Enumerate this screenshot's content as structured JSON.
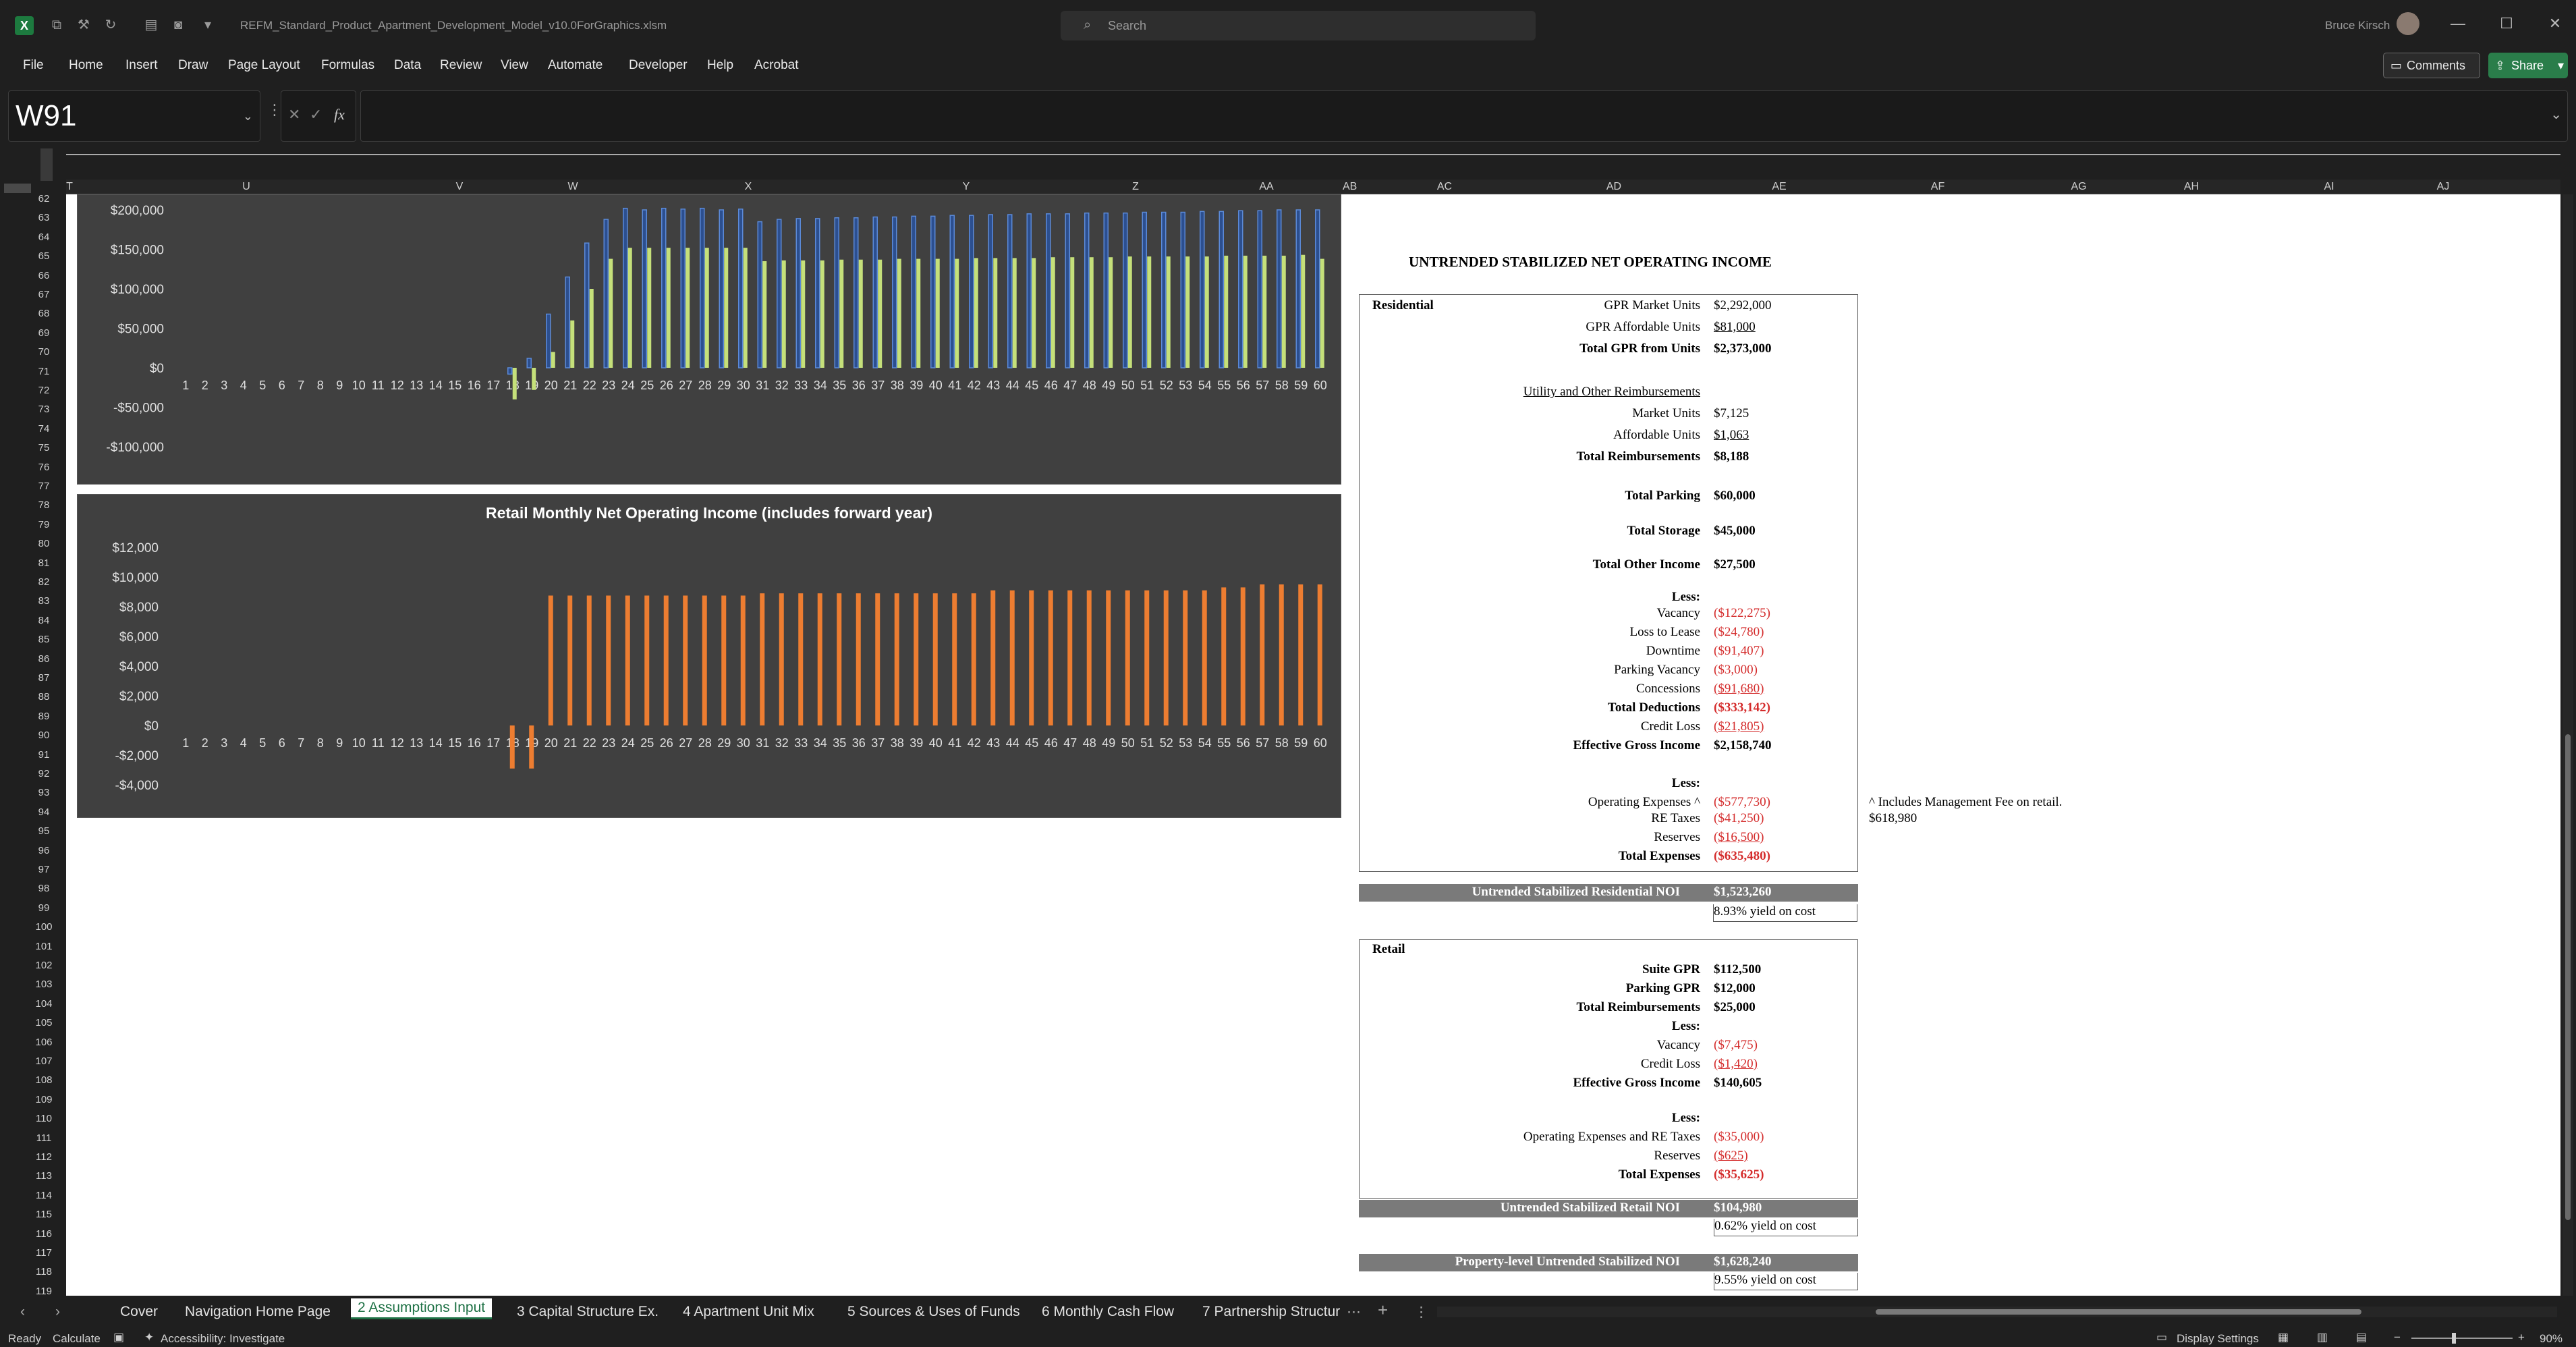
{
  "window": {
    "filename": "REFM_Standard_Product_Apartment_Development_Model_v10.0ForGraphics.xlsm",
    "search_placeholder": "Search",
    "user_name": "Bruce Kirsch"
  },
  "menu": [
    "File",
    "Home",
    "Insert",
    "Draw",
    "Page Layout",
    "Formulas",
    "Data",
    "Review",
    "View",
    "Automate",
    "Developer",
    "Help",
    "Acrobat"
  ],
  "buttons": {
    "comments": "Comments",
    "share": "Share"
  },
  "formula_bar": {
    "name_box": "W91",
    "fx": "fx",
    "content": ""
  },
  "columns": [
    "T",
    "U",
    "V",
    "W",
    "X",
    "Y",
    "Z",
    "AA",
    "AB",
    "AC",
    "AD",
    "AE",
    "AF",
    "AG",
    "AH",
    "AI",
    "AJ"
  ],
  "rows": [
    62,
    63,
    64,
    65,
    66,
    67,
    68,
    69,
    70,
    71,
    72,
    73,
    74,
    75,
    76,
    77,
    78,
    79,
    80,
    81,
    82,
    83,
    84,
    85,
    86,
    87,
    88,
    89,
    90,
    91,
    92,
    93,
    94,
    95,
    96,
    97,
    98,
    99,
    100,
    101,
    102,
    103,
    104,
    105,
    106,
    107,
    108,
    109,
    110,
    111,
    112,
    113,
    114,
    115,
    116,
    117,
    118,
    119
  ],
  "chart_data": [
    {
      "type": "bar",
      "title": "",
      "ylim": [
        -100000,
        200000
      ],
      "yticks": [
        "$200,000",
        "$150,000",
        "$100,000",
        "$50,000",
        "$0",
        "-$50,000",
        "-$100,000"
      ],
      "categories": [
        1,
        2,
        3,
        4,
        5,
        6,
        7,
        8,
        9,
        10,
        11,
        12,
        13,
        14,
        15,
        16,
        17,
        18,
        19,
        20,
        21,
        22,
        23,
        24,
        25,
        26,
        27,
        28,
        29,
        30,
        31,
        32,
        33,
        34,
        35,
        36,
        37,
        38,
        39,
        40,
        41,
        42,
        43,
        44,
        45,
        46,
        47,
        48,
        49,
        50,
        51,
        52,
        53,
        54,
        55,
        56,
        57,
        58,
        59,
        60
      ],
      "series": [
        {
          "color": "#4472c4",
          "values": [
            0,
            0,
            0,
            0,
            0,
            0,
            0,
            0,
            0,
            0,
            0,
            0,
            0,
            0,
            0,
            0,
            0,
            -8000,
            12000,
            68000,
            115000,
            158000,
            188000,
            202000,
            200000,
            202000,
            201000,
            202000,
            200000,
            201000,
            185000,
            188000,
            189000,
            189000,
            190000,
            190000,
            191000,
            191000,
            192000,
            192000,
            193000,
            193000,
            194000,
            194000,
            195000,
            195000,
            195000,
            196000,
            196000,
            196000,
            197000,
            197000,
            197000,
            198000,
            198000,
            199000,
            199000,
            200000,
            200000,
            200000
          ]
        },
        {
          "color": "#c5e07a",
          "values": [
            0,
            0,
            0,
            0,
            0,
            0,
            0,
            0,
            0,
            0,
            0,
            0,
            0,
            0,
            0,
            0,
            0,
            -40000,
            -28000,
            20000,
            60000,
            100000,
            138000,
            152000,
            152000,
            152000,
            152000,
            152000,
            152000,
            152000,
            135000,
            136000,
            136000,
            136000,
            137000,
            137000,
            137000,
            138000,
            138000,
            138000,
            138000,
            139000,
            139000,
            139000,
            139000,
            140000,
            140000,
            140000,
            140000,
            141000,
            141000,
            141000,
            141000,
            141000,
            142000,
            142000,
            142000,
            142000,
            143000,
            138000
          ]
        }
      ]
    },
    {
      "type": "bar",
      "title": "Retail Monthly Net Operating Income (includes forward year)",
      "ylim": [
        -4000,
        12000
      ],
      "yticks": [
        "$12,000",
        "$10,000",
        "$8,000",
        "$6,000",
        "$4,000",
        "$2,000",
        "$0",
        "-$2,000",
        "-$4,000"
      ],
      "categories": [
        1,
        2,
        3,
        4,
        5,
        6,
        7,
        8,
        9,
        10,
        11,
        12,
        13,
        14,
        15,
        16,
        17,
        18,
        19,
        20,
        21,
        22,
        23,
        24,
        25,
        26,
        27,
        28,
        29,
        30,
        31,
        32,
        33,
        34,
        35,
        36,
        37,
        38,
        39,
        40,
        41,
        42,
        43,
        44,
        45,
        46,
        47,
        48,
        49,
        50,
        51,
        52,
        53,
        54,
        55,
        56,
        57,
        58,
        59,
        60
      ],
      "series": [
        {
          "color": "#ed7d31",
          "values": [
            0,
            0,
            0,
            0,
            0,
            0,
            0,
            0,
            0,
            0,
            0,
            0,
            0,
            0,
            0,
            0,
            0,
            -2900,
            -2900,
            8750,
            8750,
            8750,
            8750,
            8750,
            8750,
            8750,
            8750,
            8750,
            8750,
            8750,
            8900,
            8900,
            8900,
            8900,
            8900,
            8900,
            8900,
            8900,
            8900,
            8900,
            8900,
            8900,
            9100,
            9100,
            9100,
            9100,
            9100,
            9100,
            9100,
            9100,
            9100,
            9100,
            9100,
            9100,
            9300,
            9300,
            9500,
            9500,
            9500,
            9500
          ]
        }
      ]
    }
  ],
  "noi": {
    "title": "UNTRENDED STABILIZED NET OPERATING INCOME",
    "residential": {
      "header": "Residential",
      "gpr_market_label": "GPR Market Units",
      "gpr_market": "$2,292,000",
      "gpr_aff_label": "GPR Affordable Units",
      "gpr_aff": "$81,000",
      "total_gpr_label": "Total GPR from Units",
      "total_gpr": "$2,373,000",
      "util_header": "Utility and Other Reimbursements",
      "mkt_units_label": "Market Units",
      "mkt_units": "$7,125",
      "aff_units_label": "Affordable Units",
      "aff_units": "$1,063",
      "total_reimb_label": "Total Reimbursements",
      "total_reimb": "$8,188",
      "parking_label": "Total Parking",
      "parking": "$60,000",
      "storage_label": "Total Storage",
      "storage": "$45,000",
      "other_label": "Total Other Income",
      "other": "$27,500",
      "less1": "Less:",
      "vacancy_label": "Vacancy",
      "vacancy": "($122,275)",
      "ltl_label": "Loss to Lease",
      "ltl": "($24,780)",
      "downtime_label": "Downtime",
      "downtime": "($91,407)",
      "pvac_label": "Parking Vacancy",
      "pvac": "($3,000)",
      "conc_label": "Concessions",
      "conc": "($91,680)",
      "tded_label": "Total Deductions",
      "tded": "($333,142)",
      "credit_label": "Credit Loss",
      "credit": "($21,805)",
      "egi_label": "Effective Gross Income",
      "egi": "$2,158,740",
      "less2": "Less:",
      "opex_label": "Operating Expenses ^",
      "opex": "($577,730)",
      "ret_label": "RE Taxes",
      "ret": "($41,250)",
      "res_label": "Reserves",
      "res": "($16,500)",
      "texp_label": "Total Expenses",
      "texp": "($635,480)",
      "noi_label": "Untrended Stabilized Residential NOI",
      "noi": "$1,523,260",
      "yield": "8.93% yield on cost",
      "note": "^ Includes Management Fee on retail.",
      "note_value": "$618,980"
    },
    "retail": {
      "header": "Retail",
      "suite_label": "Suite GPR",
      "suite": "$112,500",
      "pgpr_label": "Parking GPR",
      "pgpr": "$12,000",
      "reimb_label": "Total Reimbursements",
      "reimb": "$25,000",
      "less1": "Less:",
      "vac_label": "Vacancy",
      "vac": "($7,475)",
      "credit_label": "Credit Loss",
      "credit": "($1,420)",
      "egi_label": "Effective Gross Income",
      "egi": "$140,605",
      "less2": "Less:",
      "opex_label": "Operating Expenses and RE Taxes",
      "opex": "($35,000)",
      "res_label": "Reserves",
      "res": "($625)",
      "texp_label": "Total Expenses",
      "texp": "($35,625)",
      "noi_label": "Untrended Stabilized Retail NOI",
      "noi": "$104,980",
      "yield": "0.62% yield on cost"
    },
    "property": {
      "noi_label": "Property-level Untrended Stabilized NOI",
      "noi": "$1,628,240",
      "yield": "9.55% yield on cost"
    }
  },
  "tabs": [
    "Cover",
    "Navigation Home Page",
    "2 Assumptions Input",
    "3 Capital Structure Ex.",
    "4 Apartment Unit Mix",
    "5 Sources & Uses of Funds",
    "6 Monthly Cash Flow",
    "7 Partnership Structur"
  ],
  "active_tab": "2 Assumptions Input",
  "status": {
    "ready": "Ready",
    "calculate": "Calculate",
    "accessibility": "Accessibility: Investigate",
    "display_settings": "Display Settings",
    "zoom": "90%"
  }
}
